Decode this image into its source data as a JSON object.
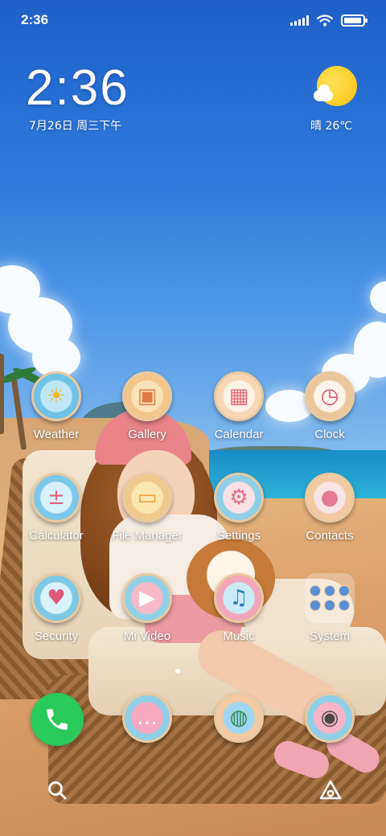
{
  "status_bar": {
    "time": "2:36",
    "icons": [
      "signal-icon",
      "wifi-icon",
      "battery-icon"
    ],
    "battery_level": 0.95
  },
  "clock_widget": {
    "time": "2:36",
    "date": "7月26日 周三下午"
  },
  "weather_widget": {
    "icon": "sunny-cloud-icon",
    "text": "晴 26℃"
  },
  "apps": [
    {
      "label": "Weather",
      "icon": "weather-icon"
    },
    {
      "label": "Gallery",
      "icon": "gallery-icon"
    },
    {
      "label": "Calendar",
      "icon": "calendar-icon"
    },
    {
      "label": "Clock",
      "icon": "clock-icon"
    },
    {
      "label": "Calculator",
      "icon": "calculator-icon"
    },
    {
      "label": "File Manager",
      "icon": "folder-icon"
    },
    {
      "label": "Settings",
      "icon": "gear-icon"
    },
    {
      "label": "Contacts",
      "icon": "contacts-icon"
    },
    {
      "label": "Security",
      "icon": "shield-icon"
    },
    {
      "label": "Mi Video",
      "icon": "video-icon"
    },
    {
      "label": "Music",
      "icon": "headphones-icon"
    },
    {
      "label": "System",
      "icon": "folder-grid-icon"
    }
  ],
  "page_indicator": {
    "current": 1
  },
  "dock": [
    {
      "icon": "phone-icon",
      "color": "#29c95a"
    },
    {
      "icon": "messages-icon"
    },
    {
      "icon": "browser-icon"
    },
    {
      "icon": "camera-icon"
    }
  ],
  "bottom_bar": {
    "left_icon": "search-icon",
    "right_icon": "assistant-icon"
  }
}
